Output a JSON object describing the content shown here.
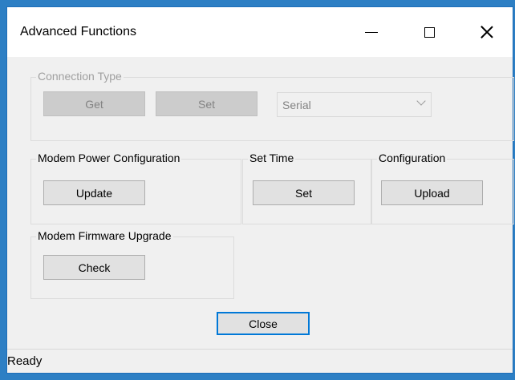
{
  "window": {
    "title": "Advanced Functions",
    "minimize_icon": "minimize-icon",
    "maximize_icon": "maximize-icon",
    "close_icon": "close-icon"
  },
  "connection_type": {
    "legend": "Connection Type",
    "get_label": "Get",
    "set_label": "Set",
    "selected_value": "Serial",
    "enabled": false
  },
  "modem_power": {
    "legend": "Modem Power Configuration",
    "update_label": "Update"
  },
  "set_time": {
    "legend": "Set Time",
    "set_label": "Set"
  },
  "configuration": {
    "legend": "Configuration",
    "upload_label": "Upload"
  },
  "firmware": {
    "legend": "Modem Firmware Upgrade",
    "check_label": "Check"
  },
  "footer": {
    "close_label": "Close"
  },
  "status": {
    "text": "Ready"
  },
  "colors": {
    "desktop": "#2d7fc4",
    "window_bg": "#f0f0f0",
    "focus_border": "#0078d7"
  }
}
